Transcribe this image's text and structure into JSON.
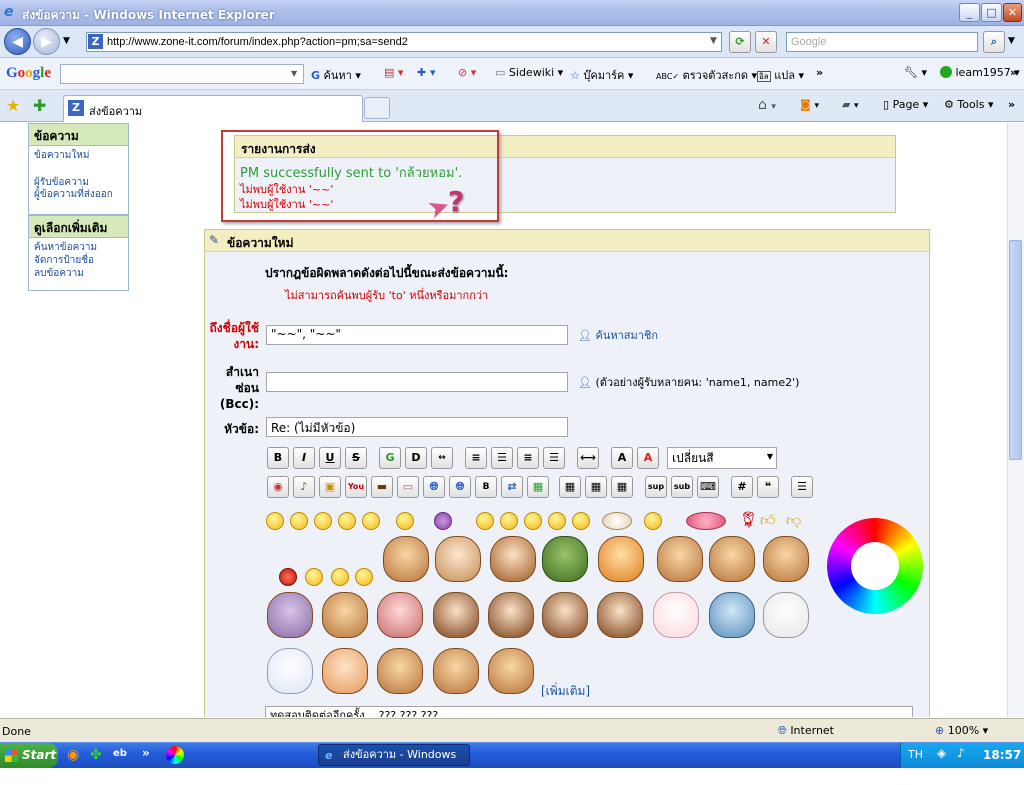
{
  "window": {
    "title": "ส่งข้อความ - Windows Internet Explorer",
    "minimize": "_",
    "maximize": "□",
    "close": "✕"
  },
  "address": {
    "url": "http://www.zone-it.com/forum/index.php?action=pm;sa=send2",
    "search_placeholder": "Google"
  },
  "google_toolbar": {
    "logo": "Google",
    "search": "ค้นหา",
    "sidewiki": "Sidewiki",
    "bookmarks": "บุ๊คมาร์ค",
    "spell": "ตรวจตัวสะกด",
    "translate": "แปล",
    "more": "»",
    "user": "leam1957"
  },
  "tab": {
    "label": "ส่งข้อความ",
    "page_menu": "Page",
    "tools_menu": "Tools"
  },
  "sidebar": {
    "section1_title": "ข้อความ",
    "section1_links": [
      "ข้อความใหม่",
      "ผู้รับข้อความ",
      "ผู้ข้อความที่ส่งออก"
    ],
    "section2_title": "ดูเลือกเพิ่มเติม",
    "section2_links": [
      "ค้นหาข้อความ",
      "จัดการป้ายชื่อ",
      "ลบข้อความ"
    ]
  },
  "report": {
    "title": "รายงานการส่ง",
    "success": "PM successfully sent to 'กล้วยหอม'.",
    "errors": [
      "ไม่พบผู้ใช้งาน '~~'",
      "ไม่พบผู้ใช้งาน '~~'"
    ],
    "help_mark": "?"
  },
  "compose": {
    "title": "ข้อความใหม่",
    "error_heading": "ปรากฎข้อผิดพลาดดังต่อไปนี้ขณะส่งข้อความนี้:",
    "error_text": "ไม่สามารถค้นพบผู้รับ 'to' หนึ่งหรือมากกว่า",
    "to_label": "ถึงชื่อผู้ใช้งาน:",
    "to_value": "\"~~\", \"~~\"",
    "find_member": "ค้นหาสมาชิก",
    "bcc_label": "สำเนาซ่อน (Bcc):",
    "bcc_value": "",
    "bcc_hint": "(ตัวอย่างผู้รับหลายคน: 'name1, name2')",
    "subject_label": "หัวข้อ:",
    "subject_value": "Re: (ไม่มีหัวข้อ)",
    "color_select": "เปลี่ยนสี",
    "more_smileys": "[เพิ่มเติม]",
    "body_text": "ทดสอบติดต่ออีกครั้ง....???    ???    ???"
  },
  "toolbar_buttons": {
    "bold": "B",
    "italic": "I",
    "underline": "U",
    "strike": "S",
    "glow": "G",
    "shadow": "D",
    "move": "↔",
    "size": "A",
    "color": "A",
    "sup": "sup",
    "sub": "sub",
    "code": "#"
  },
  "status": {
    "text": "Done",
    "zone": "Internet",
    "zoom": "100%"
  },
  "taskbar": {
    "start": "Start",
    "task": "ส่งข้อความ - Windows ...",
    "lang": "TH",
    "time": "18:57"
  },
  "colors": {
    "sidebar_header": "#d5e9ba",
    "panel_header": "#f3efc2",
    "success_text": "#2f9a3a",
    "error_text": "#d20000",
    "highlight_box": "#c23a3a"
  }
}
